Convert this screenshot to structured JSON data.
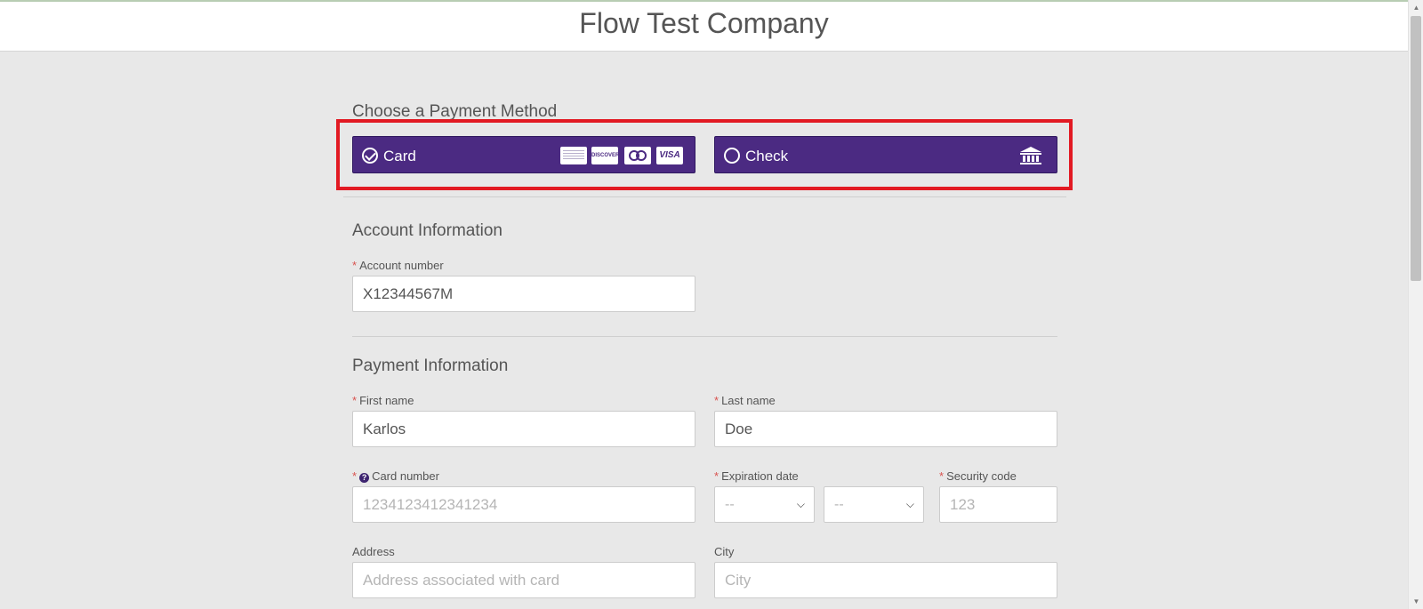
{
  "header": {
    "title": "Flow Test Company"
  },
  "payment_method": {
    "title": "Choose a Payment Method",
    "options": [
      {
        "label": "Card",
        "selected": true,
        "icons": [
          "amex-icon",
          "discover-icon",
          "mastercard-icon",
          "visa-icon"
        ]
      },
      {
        "label": "Check",
        "selected": false,
        "icons": [
          "bank-icon"
        ]
      }
    ],
    "card_logos": {
      "discover": "DISCOVER",
      "visa": "VISA"
    }
  },
  "account": {
    "title": "Account Information",
    "account_number_label": "Account number",
    "account_number_value": "X12344567M"
  },
  "payment": {
    "title": "Payment Information",
    "first_name_label": "First name",
    "first_name_value": "Karlos",
    "last_name_label": "Last name",
    "last_name_value": "Doe",
    "card_number_label": "Card number",
    "card_number_placeholder": "1234123412341234",
    "expiration_label": "Expiration date",
    "exp_month_value": "--",
    "exp_year_value": "--",
    "security_label": "Security code",
    "security_placeholder": "123",
    "address_label": "Address",
    "address_placeholder": "Address associated with card",
    "city_label": "City",
    "city_placeholder": "City"
  },
  "colors": {
    "accent": "#4b2a82",
    "highlight": "#e21a23",
    "required": "#d9534f"
  }
}
